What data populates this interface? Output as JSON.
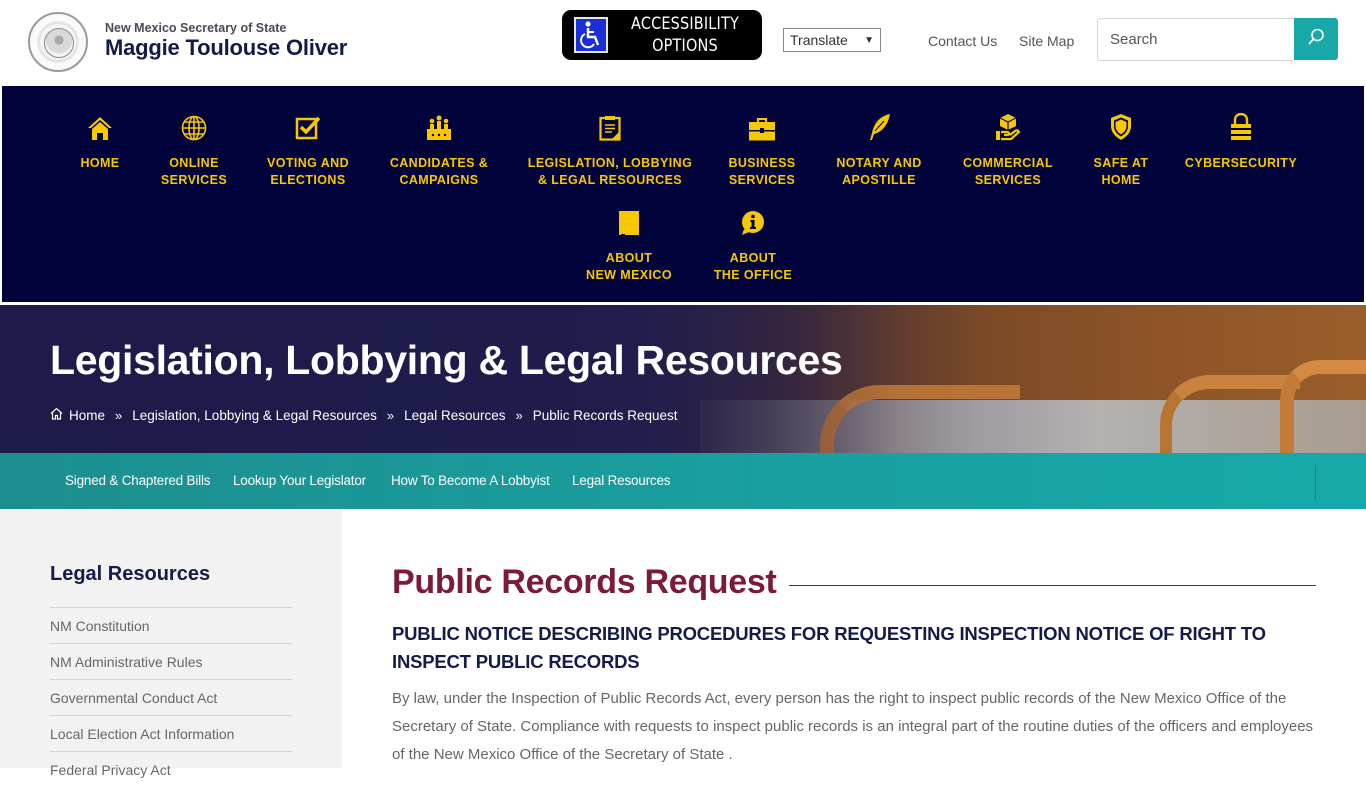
{
  "header": {
    "seal_alt": "Great Seal of the State of New Mexico",
    "brand_subtitle": "New Mexico Secretary of State",
    "brand_name": "Maggie Toulouse Oliver",
    "accessibility": {
      "line1": "ACCESSIBILITY",
      "line2": "OPTIONS",
      "icon": "wheelchair-icon"
    },
    "translate": {
      "selected": "Translate"
    },
    "links": [
      {
        "label": "Contact Us"
      },
      {
        "label": "Site Map"
      }
    ],
    "search": {
      "placeholder": "Search",
      "icon": "search-icon"
    }
  },
  "main_nav": {
    "items": [
      {
        "line1": "HOME",
        "line2": "",
        "icon": "home-icon"
      },
      {
        "line1": "ONLINE",
        "line2": "SERVICES",
        "icon": "globe-icon"
      },
      {
        "line1": "VOTING AND",
        "line2": "ELECTIONS",
        "icon": "checkbox-icon"
      },
      {
        "line1": "CANDIDATES &",
        "line2": "CAMPAIGNS",
        "icon": "candidates-icon"
      },
      {
        "line1": "LEGISLATION, LOBBYING",
        "line2": "& LEGAL RESOURCES",
        "icon": "clipboard-icon"
      },
      {
        "line1": "BUSINESS",
        "line2": "SERVICES",
        "icon": "briefcase-icon"
      },
      {
        "line1": "NOTARY AND",
        "line2": "APOSTILLE",
        "icon": "quill-icon"
      },
      {
        "line1": "COMMERCIAL",
        "line2": "SERVICES",
        "icon": "package-hand-icon"
      },
      {
        "line1": "SAFE AT",
        "line2": "HOME",
        "icon": "shield-icon"
      },
      {
        "line1": "CYBERSECURITY",
        "line2": "",
        "icon": "lock-icon"
      },
      {
        "line1": "ABOUT",
        "line2": "NEW MEXICO",
        "icon": "new-mexico-map-icon"
      },
      {
        "line1": "ABOUT",
        "line2": "THE OFFICE",
        "icon": "info-bubble-icon"
      }
    ]
  },
  "hero": {
    "title": "Legislation, Lobbying & Legal Resources",
    "breadcrumb": [
      {
        "label": "Home",
        "icon": "home-outline-icon"
      },
      {
        "label": "Legislation, Lobbying & Legal Resources"
      },
      {
        "label": "Legal Resources"
      },
      {
        "label": "Public Records Request"
      }
    ],
    "separator": "»"
  },
  "sub_nav": {
    "items": [
      {
        "label": "Signed & Chaptered Bills"
      },
      {
        "label": "Lookup Your Legislator"
      },
      {
        "label": "How To Become A Lobbyist"
      },
      {
        "label": "Legal Resources"
      }
    ]
  },
  "sidebar": {
    "title": "Legal Resources",
    "items": [
      {
        "label": "NM Constitution"
      },
      {
        "label": "NM Administrative Rules"
      },
      {
        "label": "Governmental Conduct Act"
      },
      {
        "label": "Local Election Act Information"
      },
      {
        "label": "Federal Privacy Act"
      }
    ]
  },
  "content": {
    "title": "Public Records Request",
    "notice_heading": "PUBLIC NOTICE DESCRIBING PROCEDURES FOR REQUESTING INSPECTION NOTICE OF RIGHT TO INSPECT PUBLIC RECORDS",
    "paragraph": "By law, under the Inspection of Public Records Act, every person has the right to inspect public records of the New Mexico Office of the Secretary of State. Compliance with requests to inspect public records is an integral part of the routine duties of the officers and employees of the New Mexico Office of the Secretary of State ."
  },
  "colors": {
    "nav_background": "#02033b",
    "nav_text": "#f5c800",
    "teal_accent": "#19a8a8",
    "title_maroon": "#7b1a3c",
    "brand_navy": "#141a4a"
  }
}
